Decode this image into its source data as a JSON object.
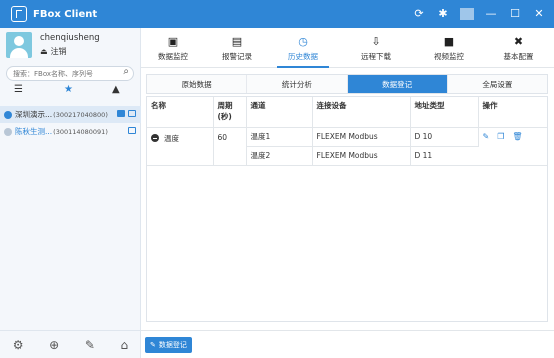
{
  "app": {
    "title": "FBox Client"
  },
  "user": {
    "name": "chenqiusheng",
    "logout_label": "注销"
  },
  "search": {
    "placeholder": "搜索：FBox名称、序列号"
  },
  "devices": [
    {
      "name": "深圳演示...",
      "sn": "(300217040800)"
    },
    {
      "name": "陈秋生测...",
      "sn": "(300114080091)"
    }
  ],
  "nav": [
    {
      "label": "数据监控",
      "icon": "monitor-icon"
    },
    {
      "label": "报警记录",
      "icon": "alarm-list-icon"
    },
    {
      "label": "历史数据",
      "icon": "history-clock-icon"
    },
    {
      "label": "远程下载",
      "icon": "download-icon"
    },
    {
      "label": "视频监控",
      "icon": "video-camera-icon"
    },
    {
      "label": "基本配置",
      "icon": "tools-icon"
    }
  ],
  "sub_tabs": [
    "原始数据",
    "统计分析",
    "数据登记",
    "全局设置"
  ],
  "table": {
    "headers": [
      "名称",
      "周期(秒)",
      "通道",
      "连接设备",
      "地址类型",
      "操作"
    ],
    "group": {
      "name": "温度",
      "period": "60"
    },
    "rows": [
      {
        "channel": "温度1",
        "device": "FLEXEM Modbus",
        "address": "D 10"
      },
      {
        "channel": "温度2",
        "device": "FLEXEM Modbus",
        "address": "D 11"
      }
    ]
  },
  "footer": {
    "register_button": "数据登记"
  },
  "colors": {
    "accent": "#2f86d6",
    "sidebar_bg": "#f4f7fb",
    "active_row": "#dde9f6"
  }
}
